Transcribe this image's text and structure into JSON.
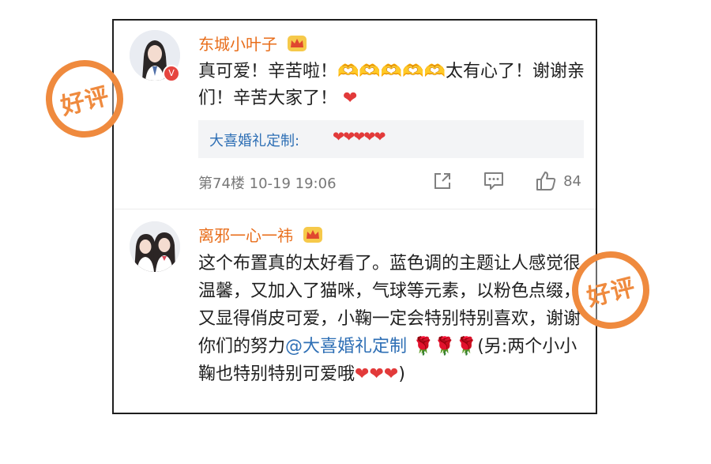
{
  "comments": [
    {
      "username": "东城小叶子",
      "avatar_icon": "avatar-girl-icon",
      "badge_icon": "crown-badge-icon",
      "verified_icon": "verified-v-icon",
      "text_part1": "真可爱！辛苦啦！",
      "hands": "🫶🫶🫶🫶🫶",
      "text_part2": "太有心了！谢谢亲们！辛苦大家了！",
      "heart": "❤",
      "reply": {
        "username": "大喜婚礼定制",
        "separator": ":",
        "text": "❤❤❤❤❤"
      },
      "meta": "第74楼  10-19 19:06",
      "like_count": "84"
    },
    {
      "username": "离邪一心一祎",
      "avatar_icon": "avatar-two-girls-icon",
      "badge_icon": "crown-badge-icon",
      "text_part1": "这个布置真的太好看了。蓝色调的主题让人感觉很温馨，又加入了猫咪，气球等元素，以粉色点缀，又显得俏皮可爱，小鞠一定会特别特别喜欢，谢谢你们的努力",
      "mention": "@大喜婚礼定制",
      "roses": "🌹🌹🌹",
      "text_part2": "(另:两个小小鞠也特别特别可爱哦",
      "hearts": "❤❤❤",
      "text_part3": ")"
    }
  ],
  "stamps": [
    "好评",
    "好评"
  ],
  "colors": {
    "username": "#e86d1a",
    "mention": "#2e6fb5",
    "stamp": "#ef8a3e",
    "heart": "#e23a3a"
  }
}
